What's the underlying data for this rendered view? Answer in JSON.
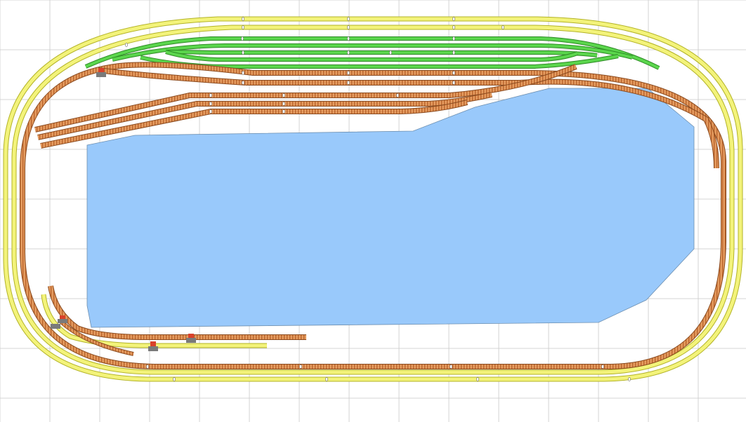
{
  "diagram": {
    "kind": "model-railway-track-plan",
    "grid": true,
    "colors": {
      "background": "#ffffff",
      "grid": "#c8c8c8",
      "water": "#99c9fb",
      "water_outline": "#6d8fb0",
      "outer_loop": "#f3f37a",
      "outer_loop_edge": "#b3b327",
      "track": "#d9823e",
      "track_edge": "#8a4a1e",
      "yard": "#5bd64d",
      "yard_edge": "#2d8a24",
      "turnout_motor": "#7a7a7a",
      "signal_head": "#d9412b"
    }
  }
}
